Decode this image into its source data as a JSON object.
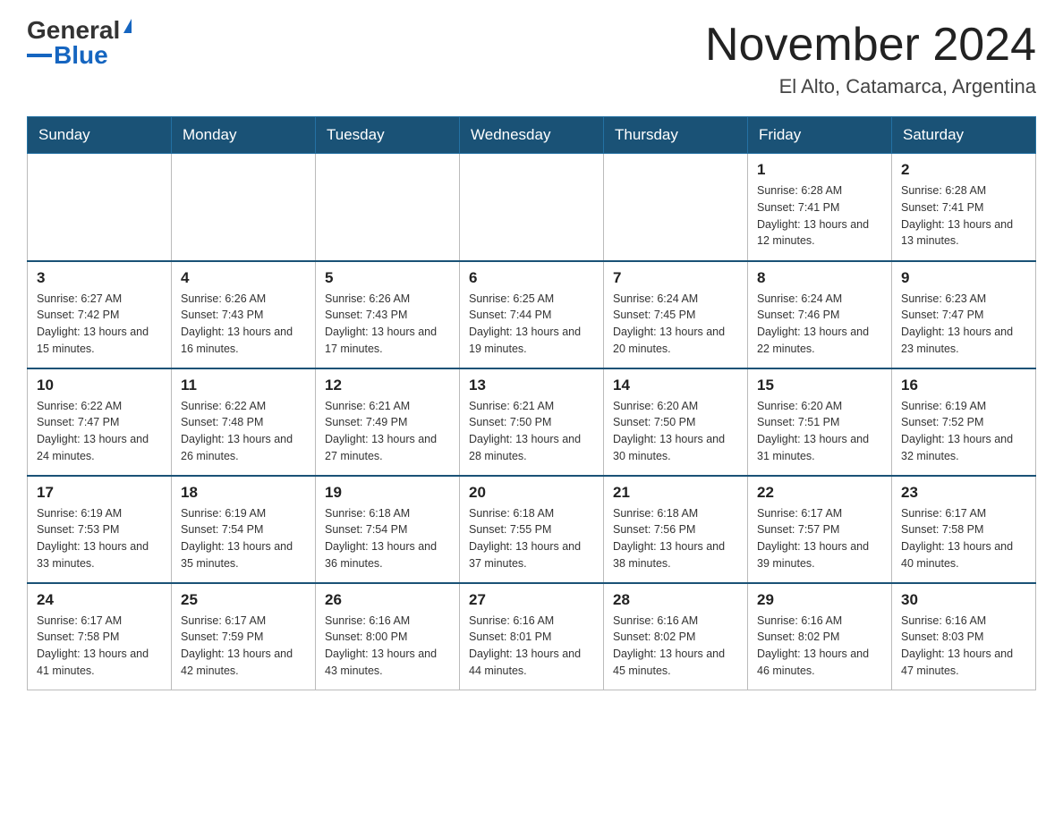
{
  "header": {
    "logo_general": "General",
    "logo_blue": "Blue",
    "month_title": "November 2024",
    "location": "El Alto, Catamarca, Argentina"
  },
  "days_of_week": [
    "Sunday",
    "Monday",
    "Tuesday",
    "Wednesday",
    "Thursday",
    "Friday",
    "Saturday"
  ],
  "weeks": [
    [
      {
        "day": "",
        "info": ""
      },
      {
        "day": "",
        "info": ""
      },
      {
        "day": "",
        "info": ""
      },
      {
        "day": "",
        "info": ""
      },
      {
        "day": "",
        "info": ""
      },
      {
        "day": "1",
        "info": "Sunrise: 6:28 AM\nSunset: 7:41 PM\nDaylight: 13 hours and 12 minutes."
      },
      {
        "day": "2",
        "info": "Sunrise: 6:28 AM\nSunset: 7:41 PM\nDaylight: 13 hours and 13 minutes."
      }
    ],
    [
      {
        "day": "3",
        "info": "Sunrise: 6:27 AM\nSunset: 7:42 PM\nDaylight: 13 hours and 15 minutes."
      },
      {
        "day": "4",
        "info": "Sunrise: 6:26 AM\nSunset: 7:43 PM\nDaylight: 13 hours and 16 minutes."
      },
      {
        "day": "5",
        "info": "Sunrise: 6:26 AM\nSunset: 7:43 PM\nDaylight: 13 hours and 17 minutes."
      },
      {
        "day": "6",
        "info": "Sunrise: 6:25 AM\nSunset: 7:44 PM\nDaylight: 13 hours and 19 minutes."
      },
      {
        "day": "7",
        "info": "Sunrise: 6:24 AM\nSunset: 7:45 PM\nDaylight: 13 hours and 20 minutes."
      },
      {
        "day": "8",
        "info": "Sunrise: 6:24 AM\nSunset: 7:46 PM\nDaylight: 13 hours and 22 minutes."
      },
      {
        "day": "9",
        "info": "Sunrise: 6:23 AM\nSunset: 7:47 PM\nDaylight: 13 hours and 23 minutes."
      }
    ],
    [
      {
        "day": "10",
        "info": "Sunrise: 6:22 AM\nSunset: 7:47 PM\nDaylight: 13 hours and 24 minutes."
      },
      {
        "day": "11",
        "info": "Sunrise: 6:22 AM\nSunset: 7:48 PM\nDaylight: 13 hours and 26 minutes."
      },
      {
        "day": "12",
        "info": "Sunrise: 6:21 AM\nSunset: 7:49 PM\nDaylight: 13 hours and 27 minutes."
      },
      {
        "day": "13",
        "info": "Sunrise: 6:21 AM\nSunset: 7:50 PM\nDaylight: 13 hours and 28 minutes."
      },
      {
        "day": "14",
        "info": "Sunrise: 6:20 AM\nSunset: 7:50 PM\nDaylight: 13 hours and 30 minutes."
      },
      {
        "day": "15",
        "info": "Sunrise: 6:20 AM\nSunset: 7:51 PM\nDaylight: 13 hours and 31 minutes."
      },
      {
        "day": "16",
        "info": "Sunrise: 6:19 AM\nSunset: 7:52 PM\nDaylight: 13 hours and 32 minutes."
      }
    ],
    [
      {
        "day": "17",
        "info": "Sunrise: 6:19 AM\nSunset: 7:53 PM\nDaylight: 13 hours and 33 minutes."
      },
      {
        "day": "18",
        "info": "Sunrise: 6:19 AM\nSunset: 7:54 PM\nDaylight: 13 hours and 35 minutes."
      },
      {
        "day": "19",
        "info": "Sunrise: 6:18 AM\nSunset: 7:54 PM\nDaylight: 13 hours and 36 minutes."
      },
      {
        "day": "20",
        "info": "Sunrise: 6:18 AM\nSunset: 7:55 PM\nDaylight: 13 hours and 37 minutes."
      },
      {
        "day": "21",
        "info": "Sunrise: 6:18 AM\nSunset: 7:56 PM\nDaylight: 13 hours and 38 minutes."
      },
      {
        "day": "22",
        "info": "Sunrise: 6:17 AM\nSunset: 7:57 PM\nDaylight: 13 hours and 39 minutes."
      },
      {
        "day": "23",
        "info": "Sunrise: 6:17 AM\nSunset: 7:58 PM\nDaylight: 13 hours and 40 minutes."
      }
    ],
    [
      {
        "day": "24",
        "info": "Sunrise: 6:17 AM\nSunset: 7:58 PM\nDaylight: 13 hours and 41 minutes."
      },
      {
        "day": "25",
        "info": "Sunrise: 6:17 AM\nSunset: 7:59 PM\nDaylight: 13 hours and 42 minutes."
      },
      {
        "day": "26",
        "info": "Sunrise: 6:16 AM\nSunset: 8:00 PM\nDaylight: 13 hours and 43 minutes."
      },
      {
        "day": "27",
        "info": "Sunrise: 6:16 AM\nSunset: 8:01 PM\nDaylight: 13 hours and 44 minutes."
      },
      {
        "day": "28",
        "info": "Sunrise: 6:16 AM\nSunset: 8:02 PM\nDaylight: 13 hours and 45 minutes."
      },
      {
        "day": "29",
        "info": "Sunrise: 6:16 AM\nSunset: 8:02 PM\nDaylight: 13 hours and 46 minutes."
      },
      {
        "day": "30",
        "info": "Sunrise: 6:16 AM\nSunset: 8:03 PM\nDaylight: 13 hours and 47 minutes."
      }
    ]
  ]
}
